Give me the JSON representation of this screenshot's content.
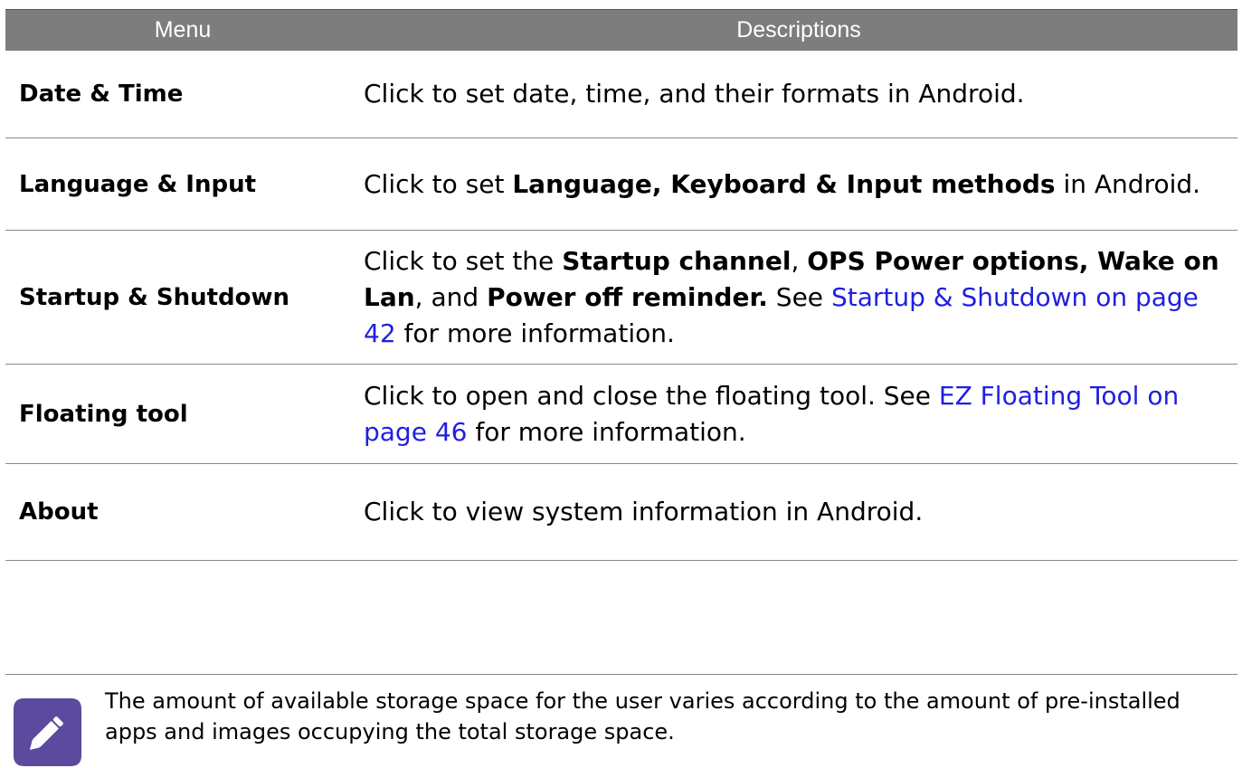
{
  "table": {
    "headers": {
      "menu": "Menu",
      "descriptions": "Descriptions"
    },
    "rows": [
      {
        "menu": "Date & Time",
        "desc": {
          "t1": "Click to set date, time, and their formats in Android."
        }
      },
      {
        "menu": "Language & Input",
        "desc": {
          "t1": "Click to set ",
          "b1": "Language, Keyboard & Input methods",
          "t2": " in Android."
        }
      },
      {
        "menu": "Startup & Shutdown",
        "desc": {
          "t1": "Click to set the ",
          "b1": "Startup channel",
          "t2": ", ",
          "b2": "OPS Power options, Wake on Lan",
          "t3": ", and ",
          "b3": "Power off reminder.",
          "t4": " See ",
          "link": "Startup & Shutdown on page 42",
          "t5": " for more information."
        }
      },
      {
        "menu": "Floating tool",
        "desc": {
          "t1": "Click to open and close the floating tool. See ",
          "link": "EZ Floating Tool on page 46",
          "t2": " for more information."
        }
      },
      {
        "menu": "About",
        "desc": {
          "t1": "Click to view system information in Android."
        }
      }
    ]
  },
  "note": {
    "icon": "pencil-note-icon",
    "text": "The amount of available storage space for the user varies according to the amount of pre-installed apps and images occupying the total storage space."
  },
  "colors": {
    "header_bg": "#7d7d7d",
    "link": "#1f1fe0",
    "icon_bg": "#5b4a9e"
  }
}
